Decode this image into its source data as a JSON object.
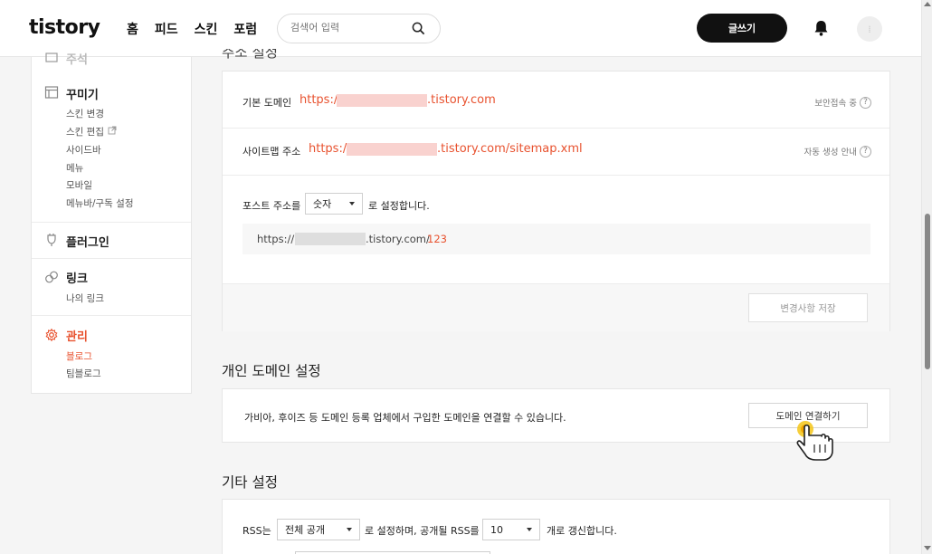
{
  "header": {
    "logo": "tistory",
    "nav": [
      "홈",
      "피드",
      "스킨",
      "포럼"
    ],
    "search_placeholder": "검색어 입력",
    "write_label": "글쓰기"
  },
  "sidebar": {
    "partial_top": "주석",
    "sections": [
      {
        "title": "꾸미기",
        "icon": "layout-icon",
        "items": [
          "스킨 변경",
          "스킨 편집",
          "사이드바",
          "메뉴",
          "모바일",
          "메뉴바/구독 설정"
        ]
      },
      {
        "title": "플러그인",
        "icon": "plug-icon",
        "items": []
      },
      {
        "title": "링크",
        "icon": "link-icon",
        "items": [
          "나의 링크"
        ]
      },
      {
        "title": "관리",
        "icon": "gear-icon",
        "items": [
          "블로그",
          "팀블로그"
        ]
      }
    ]
  },
  "address": {
    "partial_title": "주소 설정",
    "basic_label": "기본 도메인",
    "basic_url_prefix": "https://",
    "basic_url_suffix": ".tistory.com",
    "secure_help": "보안접속 중",
    "sitemap_label": "사이트맵 주소",
    "sitemap_prefix": "https://",
    "sitemap_suffix": ".tistory.com/sitemap.xml",
    "sitemap_help": "자동 생성 안내",
    "post_addr_label": "포스트 주소를",
    "post_addr_select": "숫자",
    "post_addr_suffix": "로 설정합니다.",
    "preview_prefix": "https://",
    "preview_suffix": ".tistory.com/",
    "preview_number": "123",
    "save_label": "변경사항 저장"
  },
  "custom_domain": {
    "title": "개인 도메인 설정",
    "desc": "가비아, 후이즈 등 도메인 등록 업체에서 구입한 도메인을 연결할 수 있습니다.",
    "connect_label": "도메인 연결하기"
  },
  "other": {
    "title": "기타 설정",
    "rss_label": "RSS는",
    "rss_select": "전체 공개",
    "rss_mid": "로 설정하며, 공개될 RSS를",
    "rss_count": "10",
    "rss_suffix": "개로 갱신합니다."
  }
}
